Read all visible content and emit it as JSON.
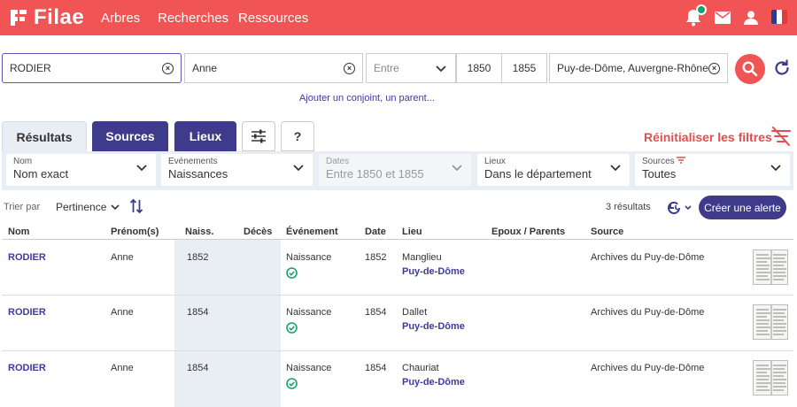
{
  "header": {
    "logo_text": "Filae",
    "nav": [
      "Arbres",
      "Recherches",
      "Ressources"
    ],
    "icons": [
      "bell-icon",
      "mail-icon",
      "user-icon",
      "french-flag-icon"
    ],
    "accent": "#f05454"
  },
  "search": {
    "surname": "RODIER",
    "firstname": "Anne",
    "event_placeholder": "Entre",
    "year_from": "1850",
    "year_to": "1855",
    "place": "Puy-de-Dôme, Auvergne-Rhône-Al",
    "add_link": "Ajouter un conjoint, un parent..."
  },
  "tabs": {
    "results": "Résultats",
    "sources": "Sources",
    "places": "Lieux",
    "filters_icon": "sliders-icon",
    "help": "?"
  },
  "reset_filters": "Réinitialiser les filtres",
  "filters": [
    {
      "label": "Nom",
      "value": "Nom exact"
    },
    {
      "label": "Evénements",
      "value": "Naissances"
    },
    {
      "label": "Dates",
      "value": "Entre 1850 et 1855"
    },
    {
      "label": "Lieux",
      "value": "Dans le département"
    },
    {
      "label": "Sources",
      "value": "Toutes"
    }
  ],
  "sort": {
    "label": "Trier par",
    "value": "Pertinence"
  },
  "results_count": "3 résultats",
  "alert_button": "Créer une alerte",
  "table": {
    "headers": [
      "Nom",
      "Prénom(s)",
      "Naiss.",
      "Décès",
      "Événement",
      "Date",
      "Lieu",
      "Epoux / Parents",
      "Source"
    ],
    "rows": [
      {
        "nom": "RODIER",
        "prenom": "Anne",
        "naiss": "1852",
        "deces": "",
        "evenement": "Naissance",
        "date": "1852",
        "lieu": "Manglieu",
        "lieu2": "Puy-de-Dôme",
        "parents": "",
        "source": "Archives du Puy-de-Dôme"
      },
      {
        "nom": "RODIER",
        "prenom": "Anne",
        "naiss": "1854",
        "deces": "",
        "evenement": "Naissance",
        "date": "1854",
        "lieu": "Dallet",
        "lieu2": "Puy-de-Dôme",
        "parents": "",
        "source": "Archives du Puy-de-Dôme"
      },
      {
        "nom": "RODIER",
        "prenom": "Anne",
        "naiss": "1854",
        "deces": "",
        "evenement": "Naissance",
        "date": "1854",
        "lieu": "Chauriat",
        "lieu2": "Puy-de-Dôme",
        "parents": "",
        "source": "Archives du Puy-de-Dôme"
      }
    ]
  },
  "colors": {
    "primary": "#3e3a8c",
    "link": "#3e3aa0",
    "success": "#1a9e74",
    "filter_bg": "#e9edf4"
  }
}
